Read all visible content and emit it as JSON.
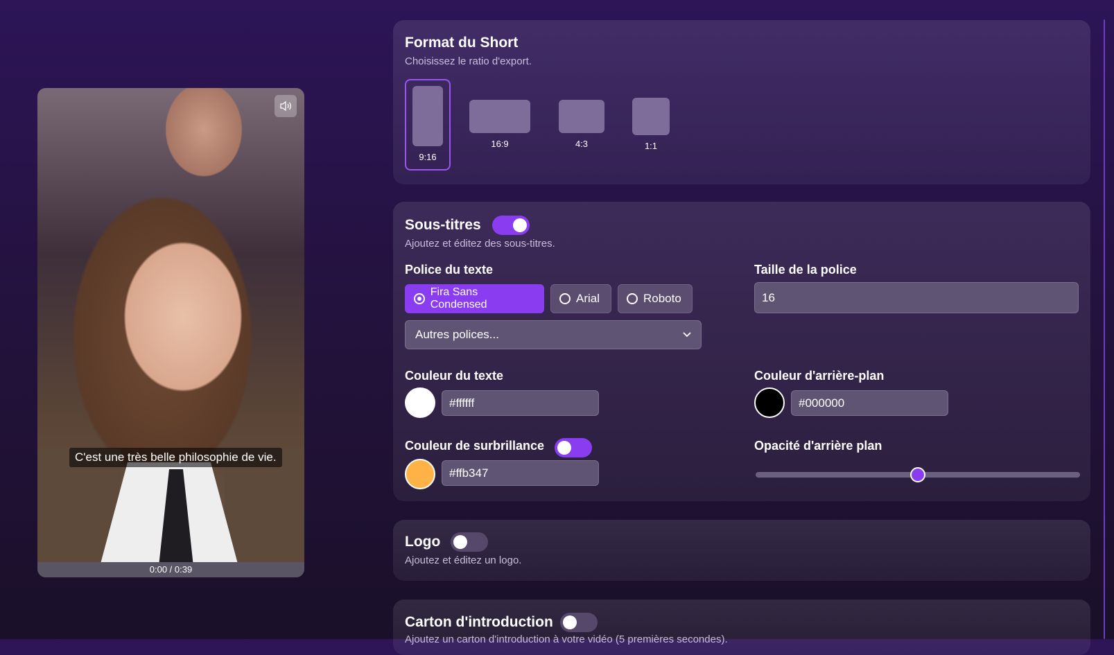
{
  "video": {
    "caption": "C'est une très belle philosophie de vie.",
    "time": "0:00 / 0:39"
  },
  "format": {
    "title": "Format du Short",
    "subtitle": "Choisissez le ratio d'export.",
    "ratios": [
      {
        "label": "9:16",
        "selected": true
      },
      {
        "label": "16:9",
        "selected": false
      },
      {
        "label": "4:3",
        "selected": false
      },
      {
        "label": "1:1",
        "selected": false
      }
    ]
  },
  "subtitles": {
    "title": "Sous-titres",
    "enabled": true,
    "subtitle": "Ajoutez et éditez des sous-titres.",
    "font_label": "Police du texte",
    "fonts": [
      {
        "label": "Fira Sans Condensed",
        "selected": true
      },
      {
        "label": "Arial",
        "selected": false
      },
      {
        "label": "Roboto",
        "selected": false
      }
    ],
    "other_fonts": "Autres polices...",
    "size_label": "Taille de la police",
    "size_value": "16",
    "text_color_label": "Couleur du texte",
    "text_color": "#ffffff",
    "bg_color_label": "Couleur d'arrière-plan",
    "bg_color": "#000000",
    "highlight_label": "Couleur de surbrillance",
    "highlight_enabled": false,
    "highlight_color": "#ffb347",
    "opacity_label": "Opacité d'arrière plan",
    "opacity": 0.5
  },
  "logo": {
    "title": "Logo",
    "enabled": false,
    "subtitle": "Ajoutez et éditez un logo."
  },
  "intro": {
    "title": "Carton d'introduction",
    "enabled": false,
    "subtitle": "Ajoutez un carton d'introduction à votre vidéo (5 premières secondes)."
  },
  "colors": {
    "accent": "#8a3df0",
    "background": "#24123f"
  }
}
